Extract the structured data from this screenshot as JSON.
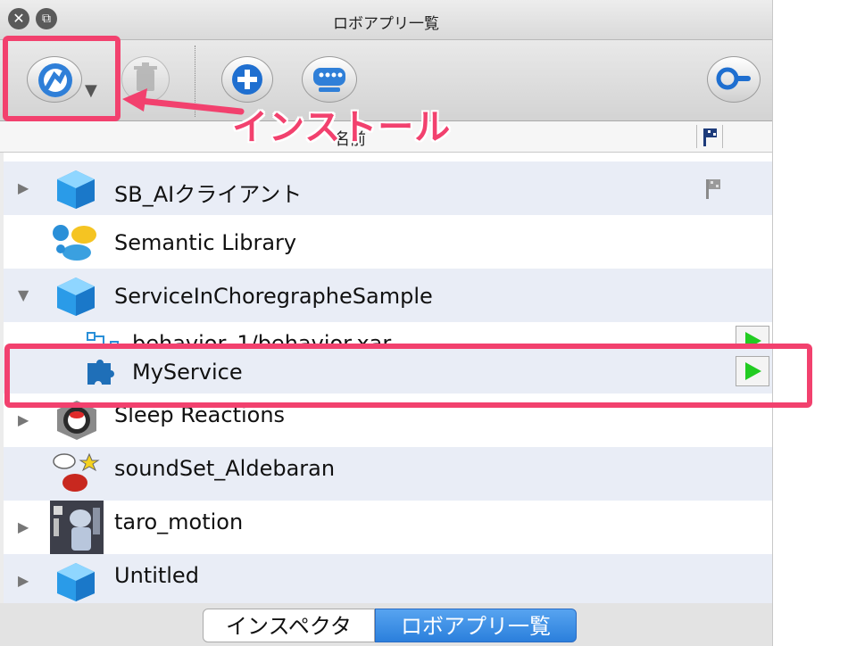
{
  "window": {
    "title": "ロボアプリ一覧",
    "close_glyph": "✕",
    "restore_glyph": "⧉"
  },
  "toolbar": {
    "buttons": [
      {
        "name": "install-button",
        "icon": "robot-install-icon"
      },
      {
        "name": "delete-button",
        "icon": "trash-icon"
      },
      {
        "name": "add-button",
        "icon": "plus-icon"
      },
      {
        "name": "device-button",
        "icon": "robot-head-icon"
      },
      {
        "name": "search-button",
        "icon": "magnifier-icon"
      }
    ],
    "dropdown_glyph": "▼"
  },
  "list_header": {
    "name_label": "名前",
    "flag_icon": "flag-icon"
  },
  "rows": [
    {
      "label": "SB_AIクライアント",
      "expand": "▶",
      "icon": "cube-icon",
      "flag": true
    },
    {
      "label": "Semantic Library",
      "expand": "",
      "icon": "speech-bubbles-icon"
    },
    {
      "label": "ServiceInChoregrapheSample",
      "expand": "▼",
      "icon": "cube-icon"
    },
    {
      "label": "behavior_1/behavior.xar",
      "expand": "",
      "icon": "behavior-graph-icon",
      "play": true
    },
    {
      "label": "MyService",
      "expand": "",
      "icon": "puzzle-piece-icon",
      "play": true
    },
    {
      "label": "Sleep Reactions",
      "expand": "▶",
      "icon": "sleep-badge-icon"
    },
    {
      "label": "soundSet_Aldebaran",
      "expand": "",
      "icon": "sound-bubbles-icon"
    },
    {
      "label": "taro_motion",
      "expand": "▶",
      "icon": "robot-photo-icon"
    },
    {
      "label": "Untitled",
      "expand": "▶",
      "icon": "cube-icon"
    }
  ],
  "annotation": {
    "text": "インストール",
    "color": "#f2416e"
  },
  "tabs": [
    {
      "label": "インスペクタ",
      "active": false
    },
    {
      "label": "ロボアプリ一覧",
      "active": true
    }
  ]
}
